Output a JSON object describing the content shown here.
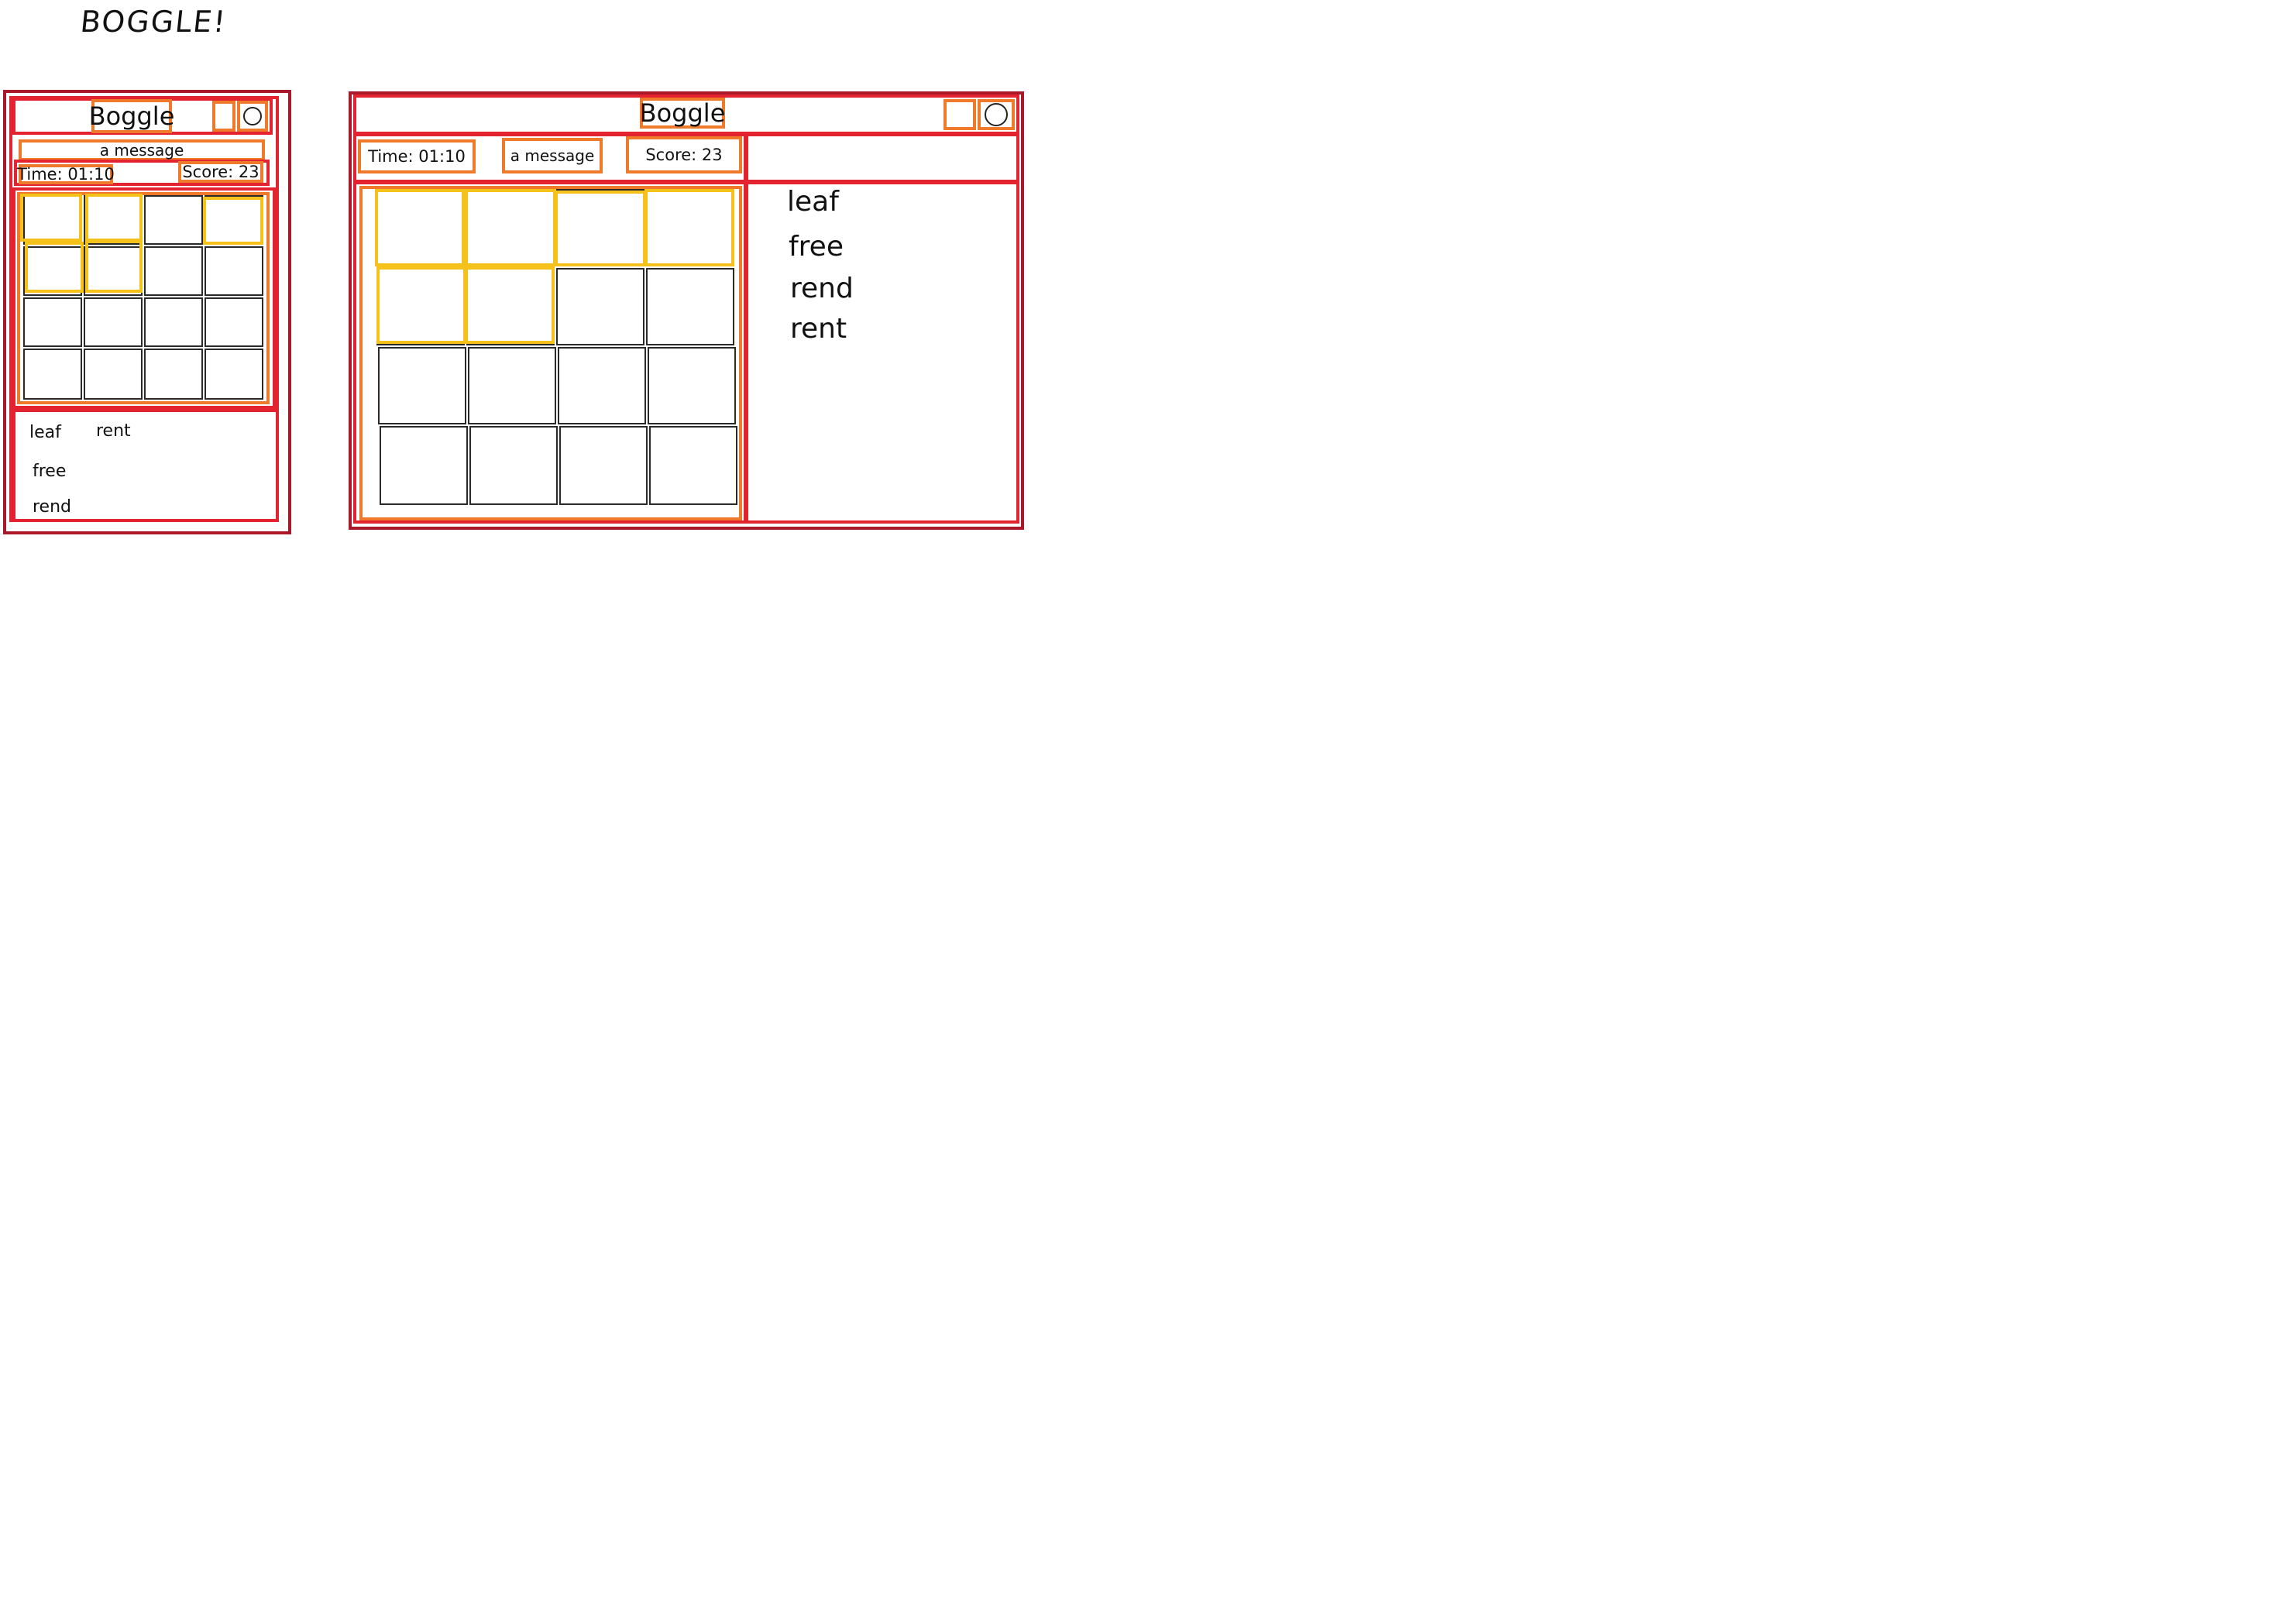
{
  "page": {
    "title": "BOGGLE!"
  },
  "mobile": {
    "header_title": "Boggle",
    "message": "a message",
    "time": "Time: 01:10",
    "score": "Score: 23",
    "words": [
      "leaf",
      "rent",
      "free",
      "rend"
    ]
  },
  "desktop": {
    "header_title": "Boggle",
    "message": "a message",
    "time": "Time: 01:10",
    "score": "Score: 23",
    "words": [
      "leaf",
      "free",
      "rend",
      "rent"
    ]
  },
  "colors": {
    "outer_frame": "#a8172a",
    "section_frame": "#e3232f",
    "control_box": "#f07a2c",
    "selected_cell": "#f5c21b",
    "cell_border": "#2a2a2a"
  },
  "icons": {
    "refresh": "refresh-icon"
  }
}
